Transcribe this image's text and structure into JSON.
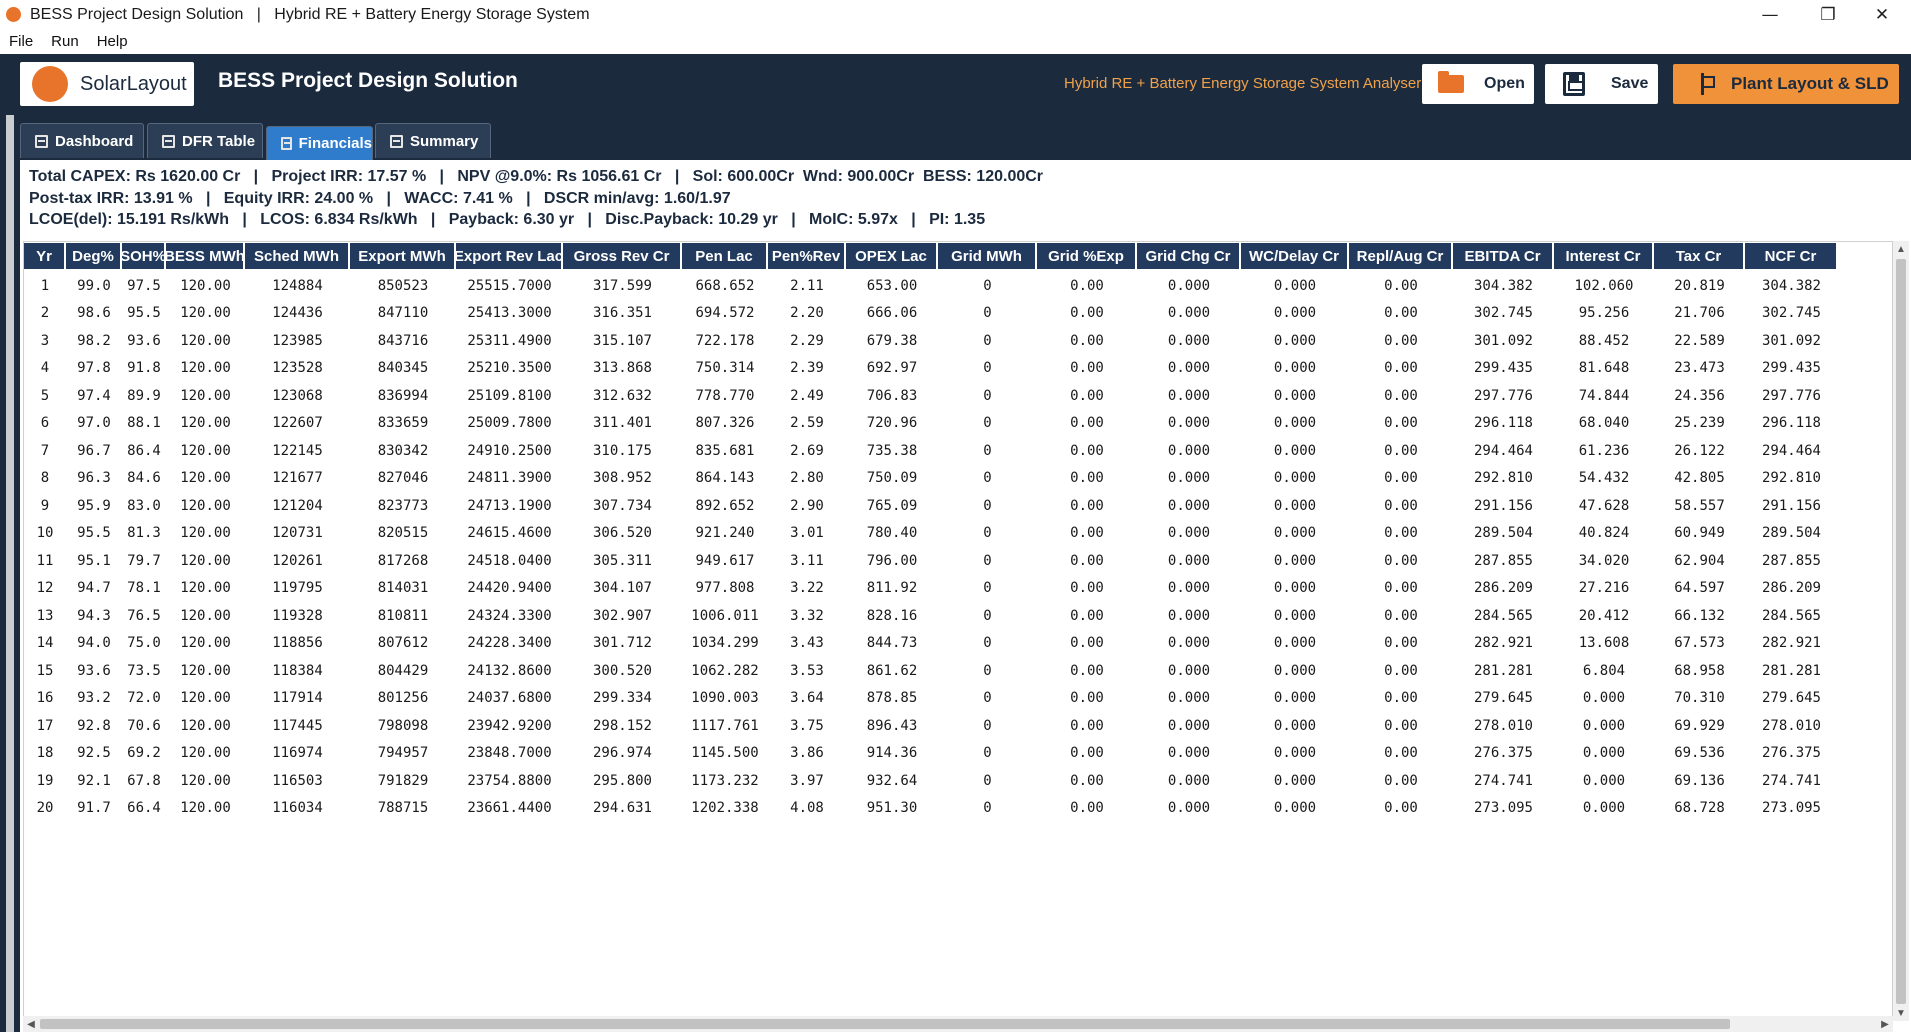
{
  "window": {
    "title": "BESS Project Design Solution   |   Hybrid RE + Battery Energy Storage System",
    "minimize_glyph": "—",
    "maximize_glyph": "❐",
    "close_glyph": "✕"
  },
  "menu": [
    "File",
    "Run",
    "Help"
  ],
  "header": {
    "logo_text": "SolarLayout",
    "title": "BESS Project Design Solution",
    "subtitle": "Hybrid RE + Battery Energy Storage System Analyser",
    "open_label": "Open",
    "save_label": "Save",
    "plant_label": "Plant Layout & SLD",
    "accent_color": "#e8742c",
    "navy_color": "#1c2a3e"
  },
  "tabs": [
    {
      "label": "Dashboard",
      "icon": "dashboard-icon"
    },
    {
      "label": "DFR Table",
      "icon": "table-icon"
    },
    {
      "label": "Financials",
      "icon": "financials-icon",
      "active": true
    },
    {
      "label": "Summary",
      "icon": "summary-icon"
    }
  ],
  "summary_lines": [
    "Total CAPEX: Rs 1620.00 Cr   |   Project IRR: 17.57 %   |   NPV @9.0%: Rs 1056.61 Cr   |   Sol: 600.00Cr  Wnd: 900.00Cr  BESS: 120.00Cr",
    "Post-tax IRR: 13.91 %   |   Equity IRR: 24.00 %   |   WACC: 7.41 %   |   DSCR min/avg: 1.60/1.97",
    "LCOE(del): 15.191 Rs/kWh   |   LCOS: 6.834 Rs/kWh   |   Payback: 6.30 yr   |   Disc.Payback: 10.29 yr   |   MoIC: 5.97x   |   PI: 1.35"
  ],
  "table": {
    "columns": [
      "Yr",
      "Deg%",
      "SOH%",
      "BESS MWh",
      "Sched MWh",
      "Export MWh",
      "Export Rev Lac",
      "Gross Rev Cr",
      "Pen Lac",
      "Pen%Rev",
      "OPEX Lac",
      "Grid MWh",
      "Grid %Exp",
      "Grid Chg Cr",
      "WC/Delay Cr",
      "Repl/Aug Cr",
      "EBITDA Cr",
      "Interest Cr",
      "Tax Cr",
      "NCF Cr"
    ],
    "rows": [
      [
        "1",
        "99.0",
        "97.5",
        "120.00",
        "124884",
        "850523",
        "25515.7000",
        "317.599",
        "668.652",
        "2.11",
        "653.00",
        "0",
        "0.00",
        "0.000",
        "0.000",
        "0.00",
        "304.382",
        "102.060",
        "20.819",
        "304.382"
      ],
      [
        "2",
        "98.6",
        "95.5",
        "120.00",
        "124436",
        "847110",
        "25413.3000",
        "316.351",
        "694.572",
        "2.20",
        "666.06",
        "0",
        "0.00",
        "0.000",
        "0.000",
        "0.00",
        "302.745",
        "95.256",
        "21.706",
        "302.745"
      ],
      [
        "3",
        "98.2",
        "93.6",
        "120.00",
        "123985",
        "843716",
        "25311.4900",
        "315.107",
        "722.178",
        "2.29",
        "679.38",
        "0",
        "0.00",
        "0.000",
        "0.000",
        "0.00",
        "301.092",
        "88.452",
        "22.589",
        "301.092"
      ],
      [
        "4",
        "97.8",
        "91.8",
        "120.00",
        "123528",
        "840345",
        "25210.3500",
        "313.868",
        "750.314",
        "2.39",
        "692.97",
        "0",
        "0.00",
        "0.000",
        "0.000",
        "0.00",
        "299.435",
        "81.648",
        "23.473",
        "299.435"
      ],
      [
        "5",
        "97.4",
        "89.9",
        "120.00",
        "123068",
        "836994",
        "25109.8100",
        "312.632",
        "778.770",
        "2.49",
        "706.83",
        "0",
        "0.00",
        "0.000",
        "0.000",
        "0.00",
        "297.776",
        "74.844",
        "24.356",
        "297.776"
      ],
      [
        "6",
        "97.0",
        "88.1",
        "120.00",
        "122607",
        "833659",
        "25009.7800",
        "311.401",
        "807.326",
        "2.59",
        "720.96",
        "0",
        "0.00",
        "0.000",
        "0.000",
        "0.00",
        "296.118",
        "68.040",
        "25.239",
        "296.118"
      ],
      [
        "7",
        "96.7",
        "86.4",
        "120.00",
        "122145",
        "830342",
        "24910.2500",
        "310.175",
        "835.681",
        "2.69",
        "735.38",
        "0",
        "0.00",
        "0.000",
        "0.000",
        "0.00",
        "294.464",
        "61.236",
        "26.122",
        "294.464"
      ],
      [
        "8",
        "96.3",
        "84.6",
        "120.00",
        "121677",
        "827046",
        "24811.3900",
        "308.952",
        "864.143",
        "2.80",
        "750.09",
        "0",
        "0.00",
        "0.000",
        "0.000",
        "0.00",
        "292.810",
        "54.432",
        "42.805",
        "292.810"
      ],
      [
        "9",
        "95.9",
        "83.0",
        "120.00",
        "121204",
        "823773",
        "24713.1900",
        "307.734",
        "892.652",
        "2.90",
        "765.09",
        "0",
        "0.00",
        "0.000",
        "0.000",
        "0.00",
        "291.156",
        "47.628",
        "58.557",
        "291.156"
      ],
      [
        "10",
        "95.5",
        "81.3",
        "120.00",
        "120731",
        "820515",
        "24615.4600",
        "306.520",
        "921.240",
        "3.01",
        "780.40",
        "0",
        "0.00",
        "0.000",
        "0.000",
        "0.00",
        "289.504",
        "40.824",
        "60.949",
        "289.504"
      ],
      [
        "11",
        "95.1",
        "79.7",
        "120.00",
        "120261",
        "817268",
        "24518.0400",
        "305.311",
        "949.617",
        "3.11",
        "796.00",
        "0",
        "0.00",
        "0.000",
        "0.000",
        "0.00",
        "287.855",
        "34.020",
        "62.904",
        "287.855"
      ],
      [
        "12",
        "94.7",
        "78.1",
        "120.00",
        "119795",
        "814031",
        "24420.9400",
        "304.107",
        "977.808",
        "3.22",
        "811.92",
        "0",
        "0.00",
        "0.000",
        "0.000",
        "0.00",
        "286.209",
        "27.216",
        "64.597",
        "286.209"
      ],
      [
        "13",
        "94.3",
        "76.5",
        "120.00",
        "119328",
        "810811",
        "24324.3300",
        "302.907",
        "1006.011",
        "3.32",
        "828.16",
        "0",
        "0.00",
        "0.000",
        "0.000",
        "0.00",
        "284.565",
        "20.412",
        "66.132",
        "284.565"
      ],
      [
        "14",
        "94.0",
        "75.0",
        "120.00",
        "118856",
        "807612",
        "24228.3400",
        "301.712",
        "1034.299",
        "3.43",
        "844.73",
        "0",
        "0.00",
        "0.000",
        "0.000",
        "0.00",
        "282.921",
        "13.608",
        "67.573",
        "282.921"
      ],
      [
        "15",
        "93.6",
        "73.5",
        "120.00",
        "118384",
        "804429",
        "24132.8600",
        "300.520",
        "1062.282",
        "3.53",
        "861.62",
        "0",
        "0.00",
        "0.000",
        "0.000",
        "0.00",
        "281.281",
        "6.804",
        "68.958",
        "281.281"
      ],
      [
        "16",
        "93.2",
        "72.0",
        "120.00",
        "117914",
        "801256",
        "24037.6800",
        "299.334",
        "1090.003",
        "3.64",
        "878.85",
        "0",
        "0.00",
        "0.000",
        "0.000",
        "0.00",
        "279.645",
        "0.000",
        "70.310",
        "279.645"
      ],
      [
        "17",
        "92.8",
        "70.6",
        "120.00",
        "117445",
        "798098",
        "23942.9200",
        "298.152",
        "1117.761",
        "3.75",
        "896.43",
        "0",
        "0.00",
        "0.000",
        "0.000",
        "0.00",
        "278.010",
        "0.000",
        "69.929",
        "278.010"
      ],
      [
        "18",
        "92.5",
        "69.2",
        "120.00",
        "116974",
        "794957",
        "23848.7000",
        "296.974",
        "1145.500",
        "3.86",
        "914.36",
        "0",
        "0.00",
        "0.000",
        "0.000",
        "0.00",
        "276.375",
        "0.000",
        "69.536",
        "276.375"
      ],
      [
        "19",
        "92.1",
        "67.8",
        "120.00",
        "116503",
        "791829",
        "23754.8800",
        "295.800",
        "1173.232",
        "3.97",
        "932.64",
        "0",
        "0.00",
        "0.000",
        "0.000",
        "0.00",
        "274.741",
        "0.000",
        "69.136",
        "274.741"
      ],
      [
        "20",
        "91.7",
        "66.4",
        "120.00",
        "116034",
        "788715",
        "23661.4400",
        "294.631",
        "1202.338",
        "4.08",
        "951.30",
        "0",
        "0.00",
        "0.000",
        "0.000",
        "0.00",
        "273.095",
        "0.000",
        "68.728",
        "273.095"
      ]
    ]
  },
  "scrollbars": {
    "up": "▲",
    "down": "▼",
    "left": "◀",
    "right": "▶"
  }
}
